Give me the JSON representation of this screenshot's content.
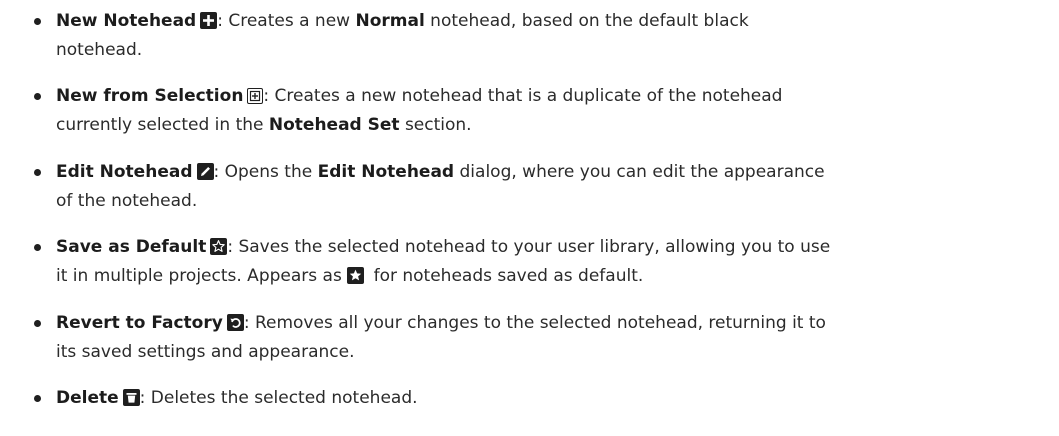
{
  "items": [
    {
      "title": "New Notehead",
      "icon": "plus-icon",
      "parts": [
        ": Creates a new ",
        "Normal",
        " notehead, based on the default black",
        "notehead."
      ]
    },
    {
      "title": "New from Selection",
      "icon": "new-from-selection-icon",
      "parts": [
        ": Creates a new notehead that is a duplicate of the notehead",
        "currently selected in the ",
        "Notehead Set",
        " section."
      ]
    },
    {
      "title": "Edit Notehead",
      "icon": "pencil-icon",
      "parts": [
        ": Opens the ",
        "Edit Notehead",
        " dialog, where you can edit the appearance",
        "of the notehead."
      ]
    },
    {
      "title": "Save as Default",
      "icon": "star-outline-icon",
      "parts": [
        ": Saves the selected notehead to your user library, allowing you to use",
        "it in multiple projects. Appears as ",
        " for noteheads saved as default."
      ],
      "inline_icon": "star-filled-icon"
    },
    {
      "title": "Revert to Factory",
      "icon": "revert-icon",
      "parts": [
        ": Removes all your changes to the selected notehead, returning it to",
        "its saved settings and appearance."
      ]
    },
    {
      "title": "Delete",
      "icon": "trash-icon",
      "parts": [
        ": Deletes the selected notehead."
      ]
    }
  ]
}
